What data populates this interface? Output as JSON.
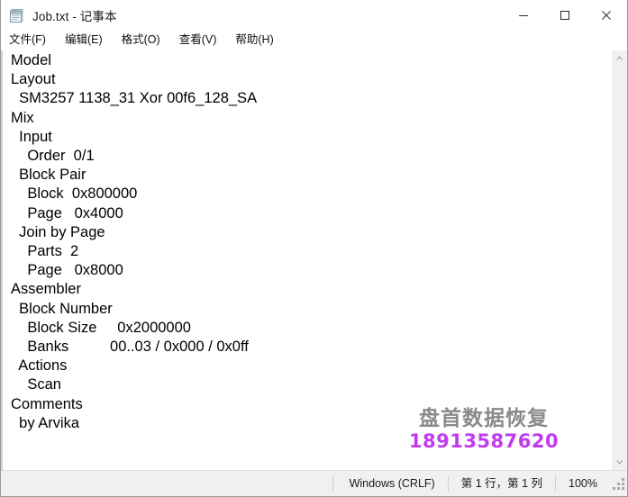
{
  "window": {
    "title": "Job.txt - 记事本",
    "icon": "notepad-icon",
    "controls": {
      "minimize": "—",
      "maximize": "☐",
      "close": "✕"
    }
  },
  "menubar": {
    "items": [
      {
        "label": "文件(F)",
        "name": "menu-file"
      },
      {
        "label": "编辑(E)",
        "name": "menu-edit"
      },
      {
        "label": "格式(O)",
        "name": "menu-format"
      },
      {
        "label": "查看(V)",
        "name": "menu-view"
      },
      {
        "label": "帮助(H)",
        "name": "menu-help"
      }
    ]
  },
  "document": {
    "lines": [
      "Model",
      "Layout",
      "  SM3257 1138_31 Xor 00f6_128_SA",
      "Mix",
      "  Input",
      "    Order  0/1",
      "  Block Pair",
      "    Block  0x800000",
      "    Page   0x4000",
      "  Join by Page",
      "    Parts  2",
      "    Page   0x8000",
      "Assembler",
      "  Block Number",
      "    Block Size     0x2000000",
      "    Banks          00..03 / 0x000 / 0x0ff",
      "  Actions",
      "    Scan",
      "Comments",
      "  by Arvika"
    ]
  },
  "watermark": {
    "chinese": "盘首数据恢复",
    "phone": "18913587620",
    "chinese_color": "#8a8a8a",
    "phone_color": "#c13af0"
  },
  "scrollbar": {
    "up_arrow": "˄",
    "down_arrow": "˅"
  },
  "statusbar": {
    "line_ending": "Windows (CRLF)",
    "cursor_position": "第 1 行，第 1 列",
    "zoom": "100%"
  }
}
